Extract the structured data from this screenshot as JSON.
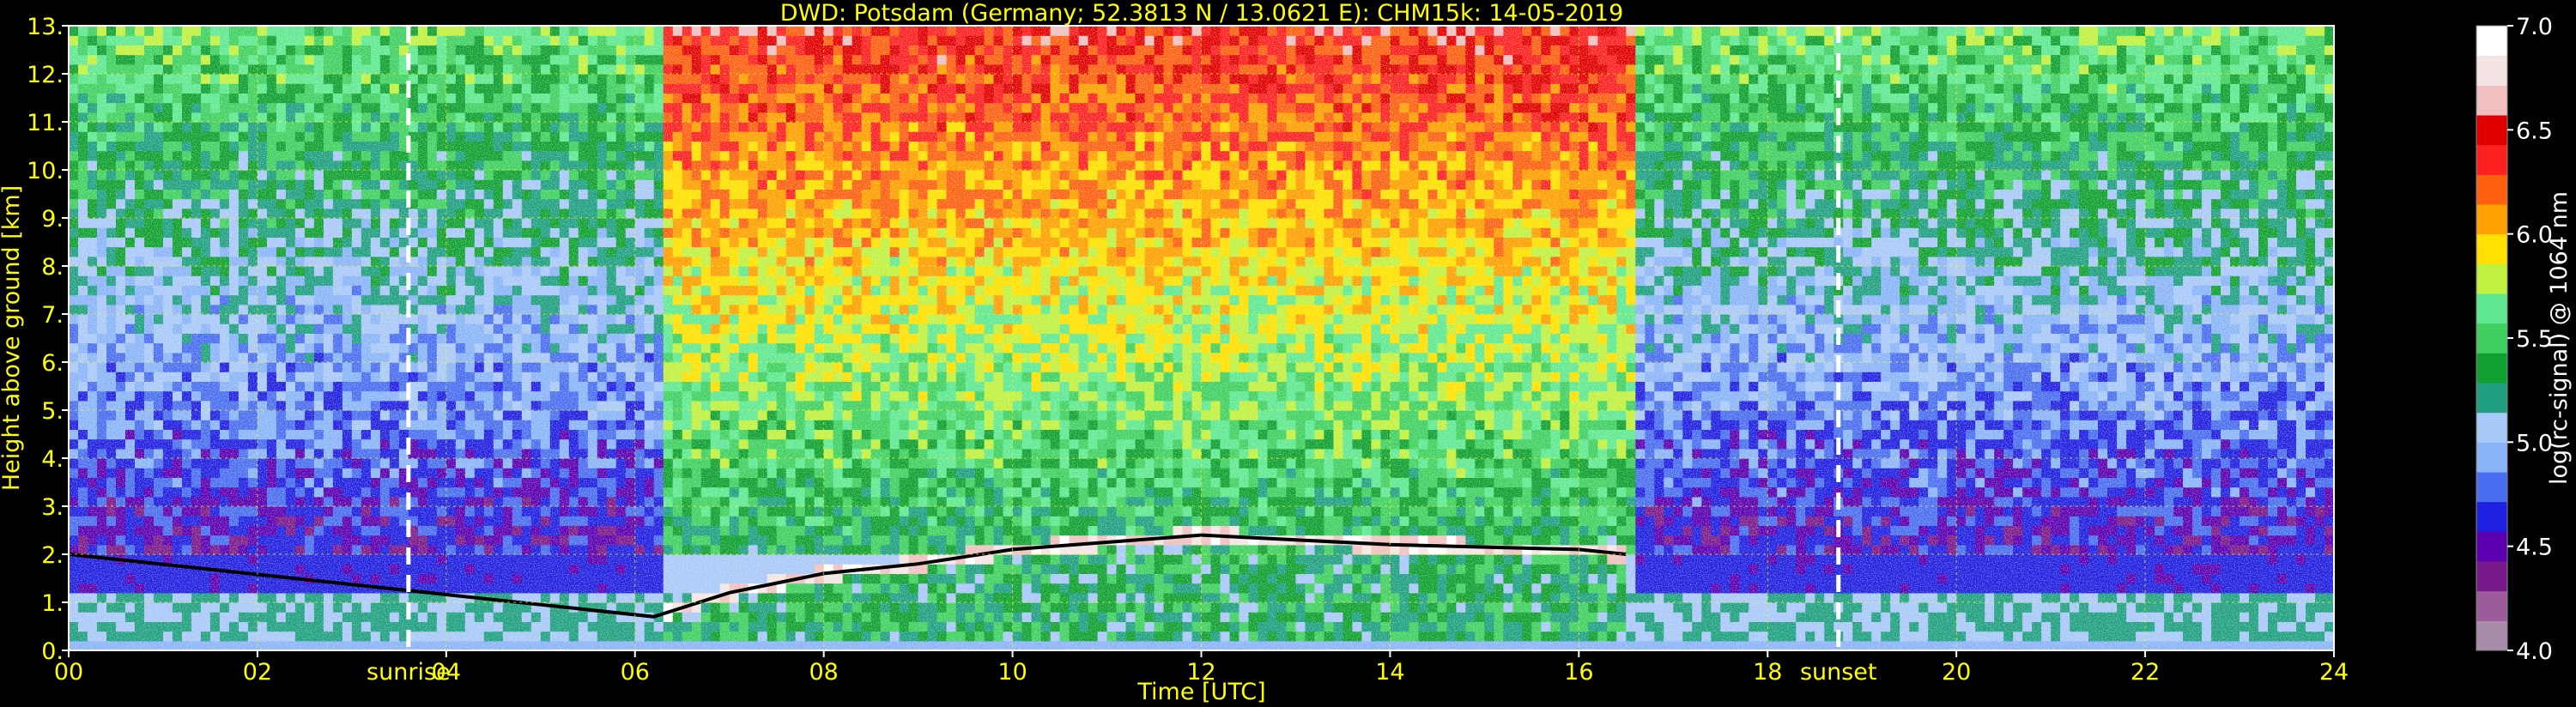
{
  "chart_data": {
    "type": "heatmap",
    "title": "DWD: Potsdam (Germany; 52.3813 N / 13.0621 E):    CHM15k: 14-05-2019",
    "xlabel": "Time [UTC]",
    "ylabel": "Height above ground [km]",
    "colorbar_label": "log(rc-signal) @ 1064 nm",
    "x_ticks": [
      "00",
      "02",
      "04",
      "06",
      "08",
      "10",
      "12",
      "14",
      "16",
      "18",
      "20",
      "22",
      "24"
    ],
    "y_ticks": [
      "0.",
      "1.",
      "2.",
      "3.",
      "4.",
      "5.",
      "6.",
      "7.",
      "8.",
      "9.",
      "10.",
      "11.",
      "12.",
      "13."
    ],
    "xlim": [
      0,
      24
    ],
    "ylim": [
      0,
      13
    ],
    "colorbar_ticks": [
      "4.0",
      "4.5",
      "5.0",
      "5.5",
      "6.0",
      "6.5",
      "7.0"
    ],
    "colorbar_range": [
      4.0,
      7.0
    ],
    "grid": true,
    "annotations": [
      {
        "text": "sunrise",
        "x": 3.6
      },
      {
        "text": "sunset",
        "x": 18.75
      }
    ],
    "boundary_layer_cloud_top_km": [
      {
        "time": 0.0,
        "height": 2.0
      },
      {
        "time": 6.2,
        "height": 0.7
      },
      {
        "time": 7.0,
        "height": 1.2
      },
      {
        "time": 8.0,
        "height": 1.6
      },
      {
        "time": 9.0,
        "height": 1.8
      },
      {
        "time": 10.0,
        "height": 2.1
      },
      {
        "time": 11.0,
        "height": 2.25
      },
      {
        "time": 12.0,
        "height": 2.4
      },
      {
        "time": 13.0,
        "height": 2.3
      },
      {
        "time": 14.0,
        "height": 2.2
      },
      {
        "time": 15.0,
        "height": 2.15
      },
      {
        "time": 16.0,
        "height": 2.1
      },
      {
        "time": 16.5,
        "height": 2.0
      }
    ],
    "colormap": [
      "#a98ca9",
      "#9a5c9a",
      "#7a1a8a",
      "#5a00b0",
      "#2020e0",
      "#4a6ef0",
      "#8ab4f8",
      "#a8c8f8",
      "#20a080",
      "#10a030",
      "#40d060",
      "#60e890",
      "#c0f040",
      "#ffe000",
      "#ffa000",
      "#ff6010",
      "#ff2020",
      "#e00000",
      "#f0c0c0",
      "#f4e4e4",
      "#ffffff"
    ]
  }
}
